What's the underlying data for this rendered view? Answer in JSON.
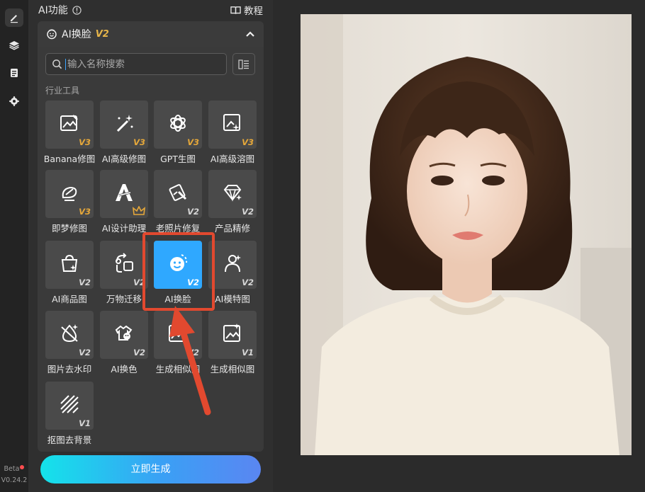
{
  "panel": {
    "title": "AI功能",
    "tutorial_label": "教程"
  },
  "dropdown": {
    "label": "AI换脸",
    "version": "V2"
  },
  "search": {
    "placeholder": "输入名称搜索"
  },
  "section_label": "行业工具",
  "tools": [
    {
      "name": "Banana修图",
      "badge": "V3",
      "icon": "image-edit-icon"
    },
    {
      "name": "AI高级修图",
      "badge": "V3",
      "icon": "magic-wand-icon"
    },
    {
      "name": "GPT生图",
      "badge": "V3",
      "icon": "gpt-logo-icon"
    },
    {
      "name": "AI高级溶图",
      "badge": "V3",
      "icon": "image-blend-icon"
    },
    {
      "name": "即梦修图",
      "badge": "V3",
      "icon": "jimeng-icon"
    },
    {
      "name": "AI设计助理",
      "badge": "crown",
      "icon": "design-a-icon"
    },
    {
      "name": "老照片修复",
      "badge": "V2",
      "icon": "photo-repair-icon"
    },
    {
      "name": "产品精修",
      "badge": "V2",
      "icon": "diamond-icon"
    },
    {
      "name": "AI商品图",
      "badge": "V2",
      "icon": "shopping-bag-icon"
    },
    {
      "name": "万物迁移",
      "badge": "V2",
      "icon": "transfer-icon"
    },
    {
      "name": "AI换脸",
      "badge": "V2",
      "icon": "face-swap-icon",
      "selected": true
    },
    {
      "name": "AI模特图",
      "badge": "V2",
      "icon": "model-icon"
    },
    {
      "name": "图片去水印",
      "badge": "V2",
      "icon": "remove-watermark-icon"
    },
    {
      "name": "AI换色",
      "badge": "V2",
      "icon": "color-swap-icon"
    },
    {
      "name": "生成相似图",
      "badge": "V2",
      "icon": "similar-image-icon"
    },
    {
      "name": "生成相似图",
      "badge": "V1",
      "icon": "similar-image-icon"
    },
    {
      "name": "抠图去背景",
      "badge": "V1",
      "icon": "remove-background-icon"
    }
  ],
  "generate_label": "立即生成",
  "version": {
    "beta": "Beta",
    "number": "V0.24.2"
  },
  "colors": {
    "selected": "#2fa8ff",
    "badge_v3": "#e6a83a",
    "highlight": "#e2492f"
  }
}
